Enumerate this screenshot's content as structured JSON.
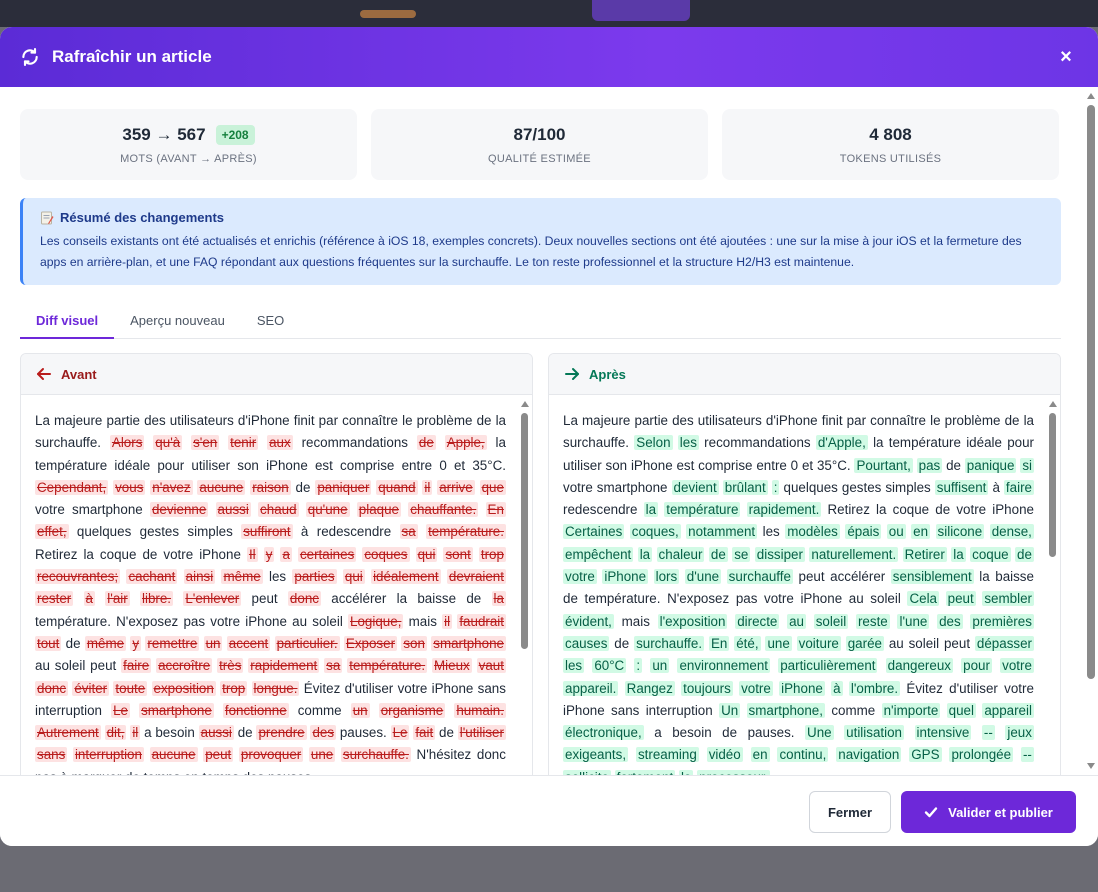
{
  "modal": {
    "title": "Rafraîchir un article",
    "close_glyph": "×"
  },
  "stats": [
    {
      "value": "359 → 567",
      "badge": "+208",
      "label": "MOTS (AVANT → APRÈS)"
    },
    {
      "value": "87/100",
      "label": "QUALITÉ ESTIMÉE"
    },
    {
      "value": "4 808",
      "label": "TOKENS UTILISÉS"
    }
  ],
  "summary": {
    "title": "Résumé des changements",
    "text": "Les conseils existants ont été actualisés et enrichis (référence à iOS 18, exemples concrets). Deux nouvelles sections ont été ajoutées : une sur la mise à jour iOS et la fermeture des apps en arrière-plan, et une FAQ répondant aux questions fréquentes sur la surchauffe. Le ton reste professionnel et la structure H2/H3 est maintenue."
  },
  "tabs": [
    {
      "label": "Diff visuel",
      "active": true
    },
    {
      "label": "Aperçu nouveau",
      "active": false
    },
    {
      "label": "SEO",
      "active": false
    }
  ],
  "before": {
    "label": "Avant",
    "segments": [
      {
        "t": "La majeure partie des utilisateurs d'iPhone finit par connaître le problème de la surchauffe. "
      },
      {
        "d": "Alors qu'à s'en tenir aux"
      },
      {
        "t": " recommandations "
      },
      {
        "d": "de Apple,"
      },
      {
        "t": " la température idéale pour utiliser son iPhone est comprise entre 0 et 35°C. "
      },
      {
        "d": "Cependant, vous n'avez aucune raison"
      },
      {
        "t": " de "
      },
      {
        "d": "paniquer quand il arrive que"
      },
      {
        "t": " votre smartphone "
      },
      {
        "d": "devienne aussi chaud qu'une plaque chauffante. En effet,"
      },
      {
        "t": " quelques gestes simples "
      },
      {
        "d": "suffiront"
      },
      {
        "t": " à redescendre "
      },
      {
        "d": "sa température."
      },
      {
        "t": " Retirez la coque de votre iPhone "
      },
      {
        "d": "Il y a certaines coques qui sont trop recouvrantes; cachant ainsi même"
      },
      {
        "t": " les "
      },
      {
        "d": "parties qui idéalement devraient rester à l'air libre. L'enlever"
      },
      {
        "t": " peut "
      },
      {
        "d": "donc"
      },
      {
        "t": " accélérer la baisse de "
      },
      {
        "d": "la"
      },
      {
        "t": " température. N'exposez pas votre iPhone au soleil "
      },
      {
        "d": "Logique,"
      },
      {
        "t": " mais "
      },
      {
        "d": "il faudrait tout"
      },
      {
        "t": " de "
      },
      {
        "d": "même y remettre un accent particulier. Exposer son smartphone"
      },
      {
        "t": " au soleil peut "
      },
      {
        "d": "faire accroître très rapidement sa température. Mieux vaut donc éviter toute exposition trop longue."
      },
      {
        "t": " Évitez d'utiliser votre iPhone sans interruption "
      },
      {
        "d": "Le smartphone fonctionne"
      },
      {
        "t": " comme "
      },
      {
        "d": "un organisme humain. Autrement dit, il"
      },
      {
        "t": " a besoin "
      },
      {
        "d": "aussi"
      },
      {
        "t": " de "
      },
      {
        "d": "prendre des"
      },
      {
        "t": " pauses. "
      },
      {
        "d": "Le fait"
      },
      {
        "t": " de "
      },
      {
        "d": "l'utiliser sans interruption aucune peut"
      },
      {
        "t": " "
      },
      {
        "d": "provoquer une surchauffe."
      },
      {
        "t": " N'hésitez donc pas à marquer de temps en temps des pauses."
      }
    ]
  },
  "after": {
    "label": "Après",
    "segments": [
      {
        "t": "La majeure partie des utilisateurs d'iPhone finit par connaître le problème de la surchauffe. "
      },
      {
        "i": "Selon les"
      },
      {
        "t": " recommandations "
      },
      {
        "i": "d'Apple,"
      },
      {
        "t": " la température idéale pour utiliser son iPhone est comprise entre 0 et 35°C. "
      },
      {
        "i": "Pourtant, pas"
      },
      {
        "t": " de "
      },
      {
        "i": "panique si"
      },
      {
        "t": " votre smartphone "
      },
      {
        "i": "devient brûlant :"
      },
      {
        "t": " quelques gestes simples "
      },
      {
        "i": "suffisent"
      },
      {
        "t": " à "
      },
      {
        "i": "faire"
      },
      {
        "t": " redescendre "
      },
      {
        "i": "la température rapidement."
      },
      {
        "t": " Retirez la coque de votre iPhone "
      },
      {
        "i": "Certaines coques, notamment"
      },
      {
        "t": " les "
      },
      {
        "i": "modèles épais ou en silicone dense, empêchent la chaleur de se dissiper naturellement. Retirer la coque de votre iPhone lors d'une surchauffe"
      },
      {
        "t": " peut accélérer "
      },
      {
        "i": "sensiblement"
      },
      {
        "t": " la baisse de température. N'exposez pas votre iPhone au soleil "
      },
      {
        "i": "Cela peut sembler évident,"
      },
      {
        "t": " mais "
      },
      {
        "i": "l'exposition directe au soleil reste l'une des premières causes"
      },
      {
        "t": " de "
      },
      {
        "i": "surchauffe. En été, une voiture garée"
      },
      {
        "t": " au soleil peut "
      },
      {
        "i": "dépasser les 60°C : un environnement particulièrement dangereux pour votre appareil. Rangez toujours votre iPhone à l'ombre."
      },
      {
        "t": " Évitez d'utiliser votre iPhone sans interruption "
      },
      {
        "i": "Un smartphone,"
      },
      {
        "t": " comme "
      },
      {
        "i": "n'importe quel appareil électronique,"
      },
      {
        "t": " a besoin de pauses. "
      },
      {
        "i": "Une utilisation intensive -- jeux exigeants, streaming vidéo en continu, navigation GPS prolongée -- sollicite fortement le processeur."
      }
    ]
  },
  "footer": {
    "close_label": "Fermer",
    "publish_label": "Valider et publier"
  },
  "colors": {
    "accent": "#6d28d9",
    "deleted_bg": "#fde2e2",
    "inserted_bg": "#d1fae5",
    "summary_bg": "#dbeafe"
  }
}
